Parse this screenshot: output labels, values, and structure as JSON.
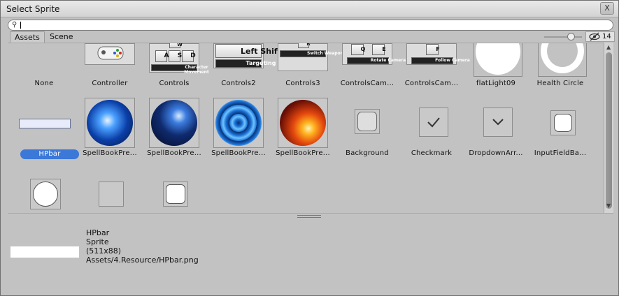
{
  "window": {
    "title": "Select Sprite",
    "close_label": "X"
  },
  "search": {
    "value": "",
    "placeholder": ""
  },
  "tabs": [
    {
      "label": "Assets"
    },
    {
      "label": "Scene"
    }
  ],
  "visibility": {
    "count": "14"
  },
  "assets": [
    {
      "label": "None"
    },
    {
      "label": "Controller"
    },
    {
      "label": "Controls",
      "keys": [
        "W",
        "A",
        "S",
        "D"
      ],
      "caption": "Character Movement"
    },
    {
      "label": "Controls2",
      "key": "Left Shift",
      "caption": "Targeting"
    },
    {
      "label": "Controls3",
      "key": "R",
      "caption": "Switch Weapon"
    },
    {
      "label": "ControlsCam...",
      "keys": [
        "Q",
        "E"
      ],
      "caption": "Rotate Camera"
    },
    {
      "label": "ControlsCam...",
      "key": "F",
      "caption": "Follow Camera"
    },
    {
      "label": "flatLight09"
    },
    {
      "label": "Health Circle"
    },
    {
      "label": "HPbar"
    },
    {
      "label": "SpellBookPre..."
    },
    {
      "label": "SpellBookPre..."
    },
    {
      "label": "SpellBookPre..."
    },
    {
      "label": "SpellBookPre..."
    },
    {
      "label": "Background"
    },
    {
      "label": "Checkmark"
    },
    {
      "label": "DropdownArr..."
    },
    {
      "label": "InputFieldBa..."
    },
    {
      "label": ""
    },
    {
      "label": ""
    },
    {
      "label": ""
    }
  ],
  "selected": {
    "name": "HPbar",
    "type": "Sprite",
    "size": "(511x88)",
    "path": "Assets/4.Resource/HPbar.png"
  },
  "colors": {
    "selection": "#3b78d8",
    "panel": "#c2c2c2"
  }
}
